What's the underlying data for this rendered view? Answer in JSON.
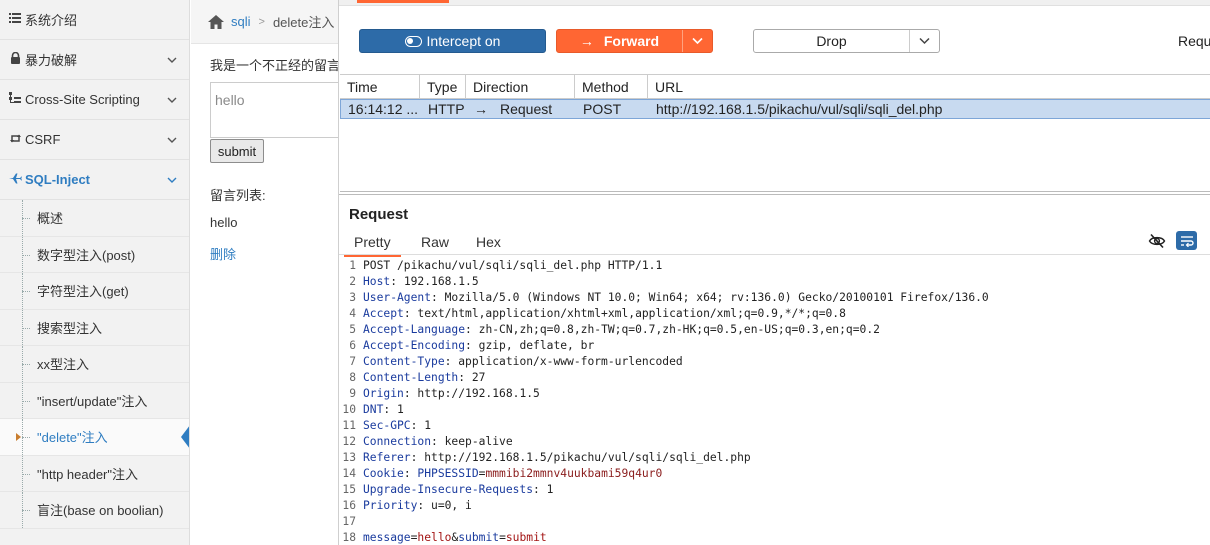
{
  "sidebar": {
    "menus": [
      {
        "label": "系统介绍",
        "icon": "list-icon"
      },
      {
        "label": "暴力破解",
        "icon": "lock-icon"
      },
      {
        "label": "Cross-Site Scripting",
        "icon": "sitemap-icon"
      },
      {
        "label": "CSRF",
        "icon": "retweet-icon"
      },
      {
        "label": "SQL-Inject",
        "icon": "plane-icon"
      }
    ],
    "sub_items": [
      {
        "label": "概述"
      },
      {
        "label": "数字型注入(post)"
      },
      {
        "label": "字符型注入(get)"
      },
      {
        "label": "搜索型注入"
      },
      {
        "label": "xx型注入"
      },
      {
        "label": "\"insert/update\"注入"
      },
      {
        "label": "\"delete\"注入"
      },
      {
        "label": "\"http header\"注入"
      },
      {
        "label": "盲注(base on boolian)"
      }
    ],
    "active_sub": "\"delete\"注入",
    "accent_color": "#2f7dc1"
  },
  "page": {
    "breadcrumb": {
      "section": "sqli",
      "current": "delete注入"
    },
    "intro": "我是一个不正经的留言板",
    "message_value": "hello",
    "submit_label": "submit",
    "list_title": "留言列表:",
    "messages": [
      {
        "text": "hello",
        "delete_label": "删除"
      }
    ]
  },
  "burp": {
    "toolbar": {
      "intercept_label": "Intercept on",
      "forward_label": "Forward",
      "drop_label": "Drop",
      "request_label": "Reque"
    },
    "table": {
      "columns": [
        "Time",
        "Type",
        "Direction",
        "Method",
        "URL"
      ],
      "rows": [
        {
          "time": "16:14:12 ...",
          "type": "HTTP",
          "direction": "Request",
          "method": "POST",
          "url": "http://192.168.1.5/pikachu/vul/sqli/sqli_del.php"
        }
      ]
    },
    "request": {
      "title": "Request",
      "tabs": [
        "Pretty",
        "Raw",
        "Hex"
      ],
      "active_tab": "Pretty",
      "lines": [
        {
          "n": "1",
          "text": "POST /pikachu/vul/sqli/sqli_del.php HTTP/1.1"
        },
        {
          "n": "2",
          "key": "Host",
          "value": "192.168.1.5"
        },
        {
          "n": "3",
          "key": "User-Agent",
          "value": "Mozilla/5.0 (Windows NT 10.0; Win64; x64; rv:136.0) Gecko/20100101 Firefox/136.0"
        },
        {
          "n": "4",
          "key": "Accept",
          "value": "text/html,application/xhtml+xml,application/xml;q=0.9,*/*;q=0.8"
        },
        {
          "n": "5",
          "key": "Accept-Language",
          "value": "zh-CN,zh;q=0.8,zh-TW;q=0.7,zh-HK;q=0.5,en-US;q=0.3,en;q=0.2"
        },
        {
          "n": "6",
          "key": "Accept-Encoding",
          "value": "gzip, deflate, br"
        },
        {
          "n": "7",
          "key": "Content-Type",
          "value": "application/x-www-form-urlencoded"
        },
        {
          "n": "8",
          "key": "Content-Length",
          "value": "27"
        },
        {
          "n": "9",
          "key": "Origin",
          "value": "http://192.168.1.5"
        },
        {
          "n": "10",
          "key": "DNT",
          "value": "1"
        },
        {
          "n": "11",
          "key": "Sec-GPC",
          "value": "1"
        },
        {
          "n": "12",
          "key": "Connection",
          "value": "keep-alive"
        },
        {
          "n": "13",
          "key": "Referer",
          "value": "http://192.168.1.5/pikachu/vul/sqli/sqli_del.php"
        },
        {
          "n": "14",
          "key": "Cookie",
          "cookie_name": "PHPSESSID",
          "cookie_value": "mmmibi2mmnv4uukbami59q4ur0"
        },
        {
          "n": "15",
          "key": "Upgrade-Insecure-Requests",
          "value": "1"
        },
        {
          "n": "16",
          "key": "Priority",
          "value": "u=0, i"
        },
        {
          "n": "17",
          "text": ""
        },
        {
          "n": "18",
          "params": [
            {
              "k": "message",
              "v": "hello"
            },
            {
              "k": "submit",
              "v": "submit"
            }
          ]
        }
      ]
    },
    "colors": {
      "forward": "#ff6633",
      "intercept": "#2d6ba8",
      "selected_row": "#c8daf0"
    }
  }
}
